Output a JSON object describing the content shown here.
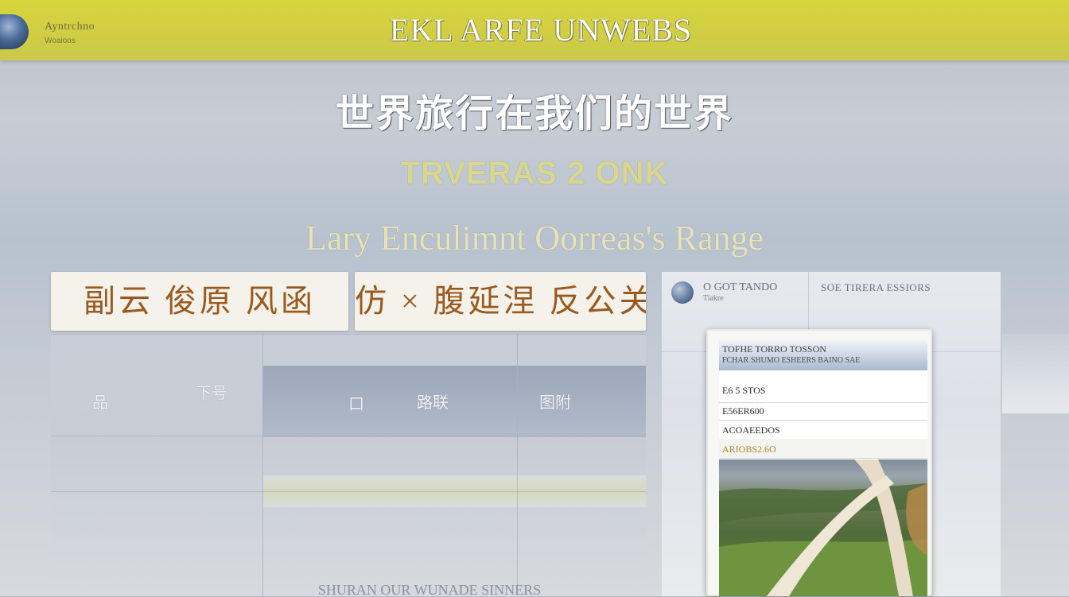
{
  "header": {
    "logo_name": "Ayntrchno",
    "logo_sub": "Woaioos",
    "title": "EKL ARFE UNWEBS"
  },
  "hero": {
    "title_cn": "世界旅行在我们的世界",
    "subtitle": "TRVERAS 2 ONK",
    "english": "Lary Enculimnt Oorreas's Range"
  },
  "tabs": [
    {
      "label": "副云 俊原 风函"
    },
    {
      "label": "仿 ×  腹延涅 反公关"
    }
  ],
  "grid": {
    "cells": [
      "品",
      "下号",
      "口",
      "路联",
      "图附"
    ],
    "footer": "SHURAN OUR WUNADE SINNERS"
  },
  "right_panel": {
    "title": "O GOT  TANDO",
    "sub": "Tiakre",
    "right_title": "SOE TIRERA ESSIORS"
  },
  "card": {
    "header_title": "TOFHE TORRO TOSSON",
    "header_sub": "FCHAR SHUMO ESHEERS BAINO SAE",
    "row1": "E6 5 STOS",
    "row2": "E56ER600",
    "row3": "ACOAEEDOS",
    "row4": "ARIOBS2.6O"
  },
  "colors": {
    "topbar": "#d8d53c",
    "tab_text": "#9a5a1f",
    "hero_sub": "#d8d691"
  }
}
